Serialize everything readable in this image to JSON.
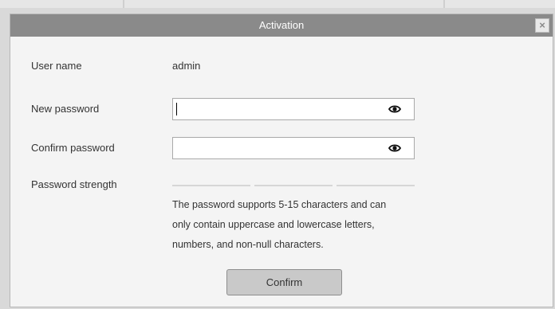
{
  "dialog": {
    "title": "Activation",
    "close_symbol": "×"
  },
  "form": {
    "username_label": "User name",
    "username_value": "admin",
    "new_password_label": "New password",
    "new_password_value": "",
    "confirm_password_label": "Confirm password",
    "confirm_password_value": "",
    "strength_label": "Password strength",
    "strength_level": 0,
    "hint_lines": [
      "The password supports 5-15 characters and can",
      "only contain uppercase and lowercase letters,",
      "numbers, and non-null characters."
    ],
    "confirm_label": "Confirm"
  },
  "icons": {
    "close": "close-icon",
    "password_visibility": "eye-icon"
  },
  "colors": {
    "titlebar": "#8a8a8a",
    "dialog_bg": "#f4f4f4",
    "button_bg": "#c9c9c9",
    "strength_bar_empty": "#d6d6d6"
  }
}
